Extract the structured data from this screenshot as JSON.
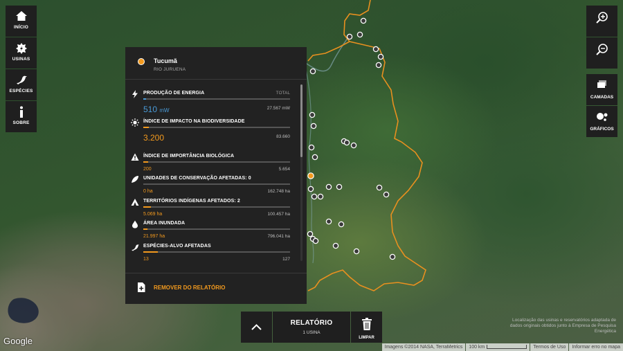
{
  "nav": {
    "items": [
      {
        "label": "INÍCIO",
        "icon": "home-icon"
      },
      {
        "label": "USINAS",
        "icon": "power-plant-icon"
      },
      {
        "label": "ESPÉCIES",
        "icon": "bird-icon"
      },
      {
        "label": "SOBRE",
        "icon": "info-icon"
      }
    ]
  },
  "tools": {
    "zoom_in_icon": "zoom-in-icon",
    "zoom_out_icon": "zoom-out-icon",
    "layers_label": "CAMADAS",
    "charts_label": "GRÁFICOS"
  },
  "panel": {
    "plant_name": "Tucumã",
    "river": "RIO JURUENA",
    "metrics": [
      {
        "title": "PRODUÇÃO DE ENERGIA",
        "total_label": "TOTAL",
        "value": "510",
        "unit": "mW",
        "max": "27.567 mW",
        "fraction": 0.02,
        "color": "blue",
        "icon": "lightning-icon"
      },
      {
        "title": "ÍNDICE DE IMPACTO NA BIODIVERSIDADE",
        "value": "3.200",
        "max": "83.660",
        "fraction": 0.04,
        "color": "orange",
        "icon": "sun-icon"
      },
      {
        "title": "ÍNDICE DE IMPORTÂNCIA BIOLÓGICA",
        "value": "200",
        "max": "5.654",
        "fraction": 0.035,
        "color": "orange",
        "icon": "warning-icon"
      },
      {
        "title": "UNIDADES DE CONSERVAÇÃO AFETADAS: 0",
        "value": "0 ha",
        "max": "162.748 ha",
        "fraction": 0.0,
        "color": "orange",
        "icon": "leaf-icon"
      },
      {
        "title": "TERRITÓRIOS INDÍGENAS AFETADOS: 2",
        "value": "5.069 ha",
        "max": "100.457 ha",
        "fraction": 0.05,
        "color": "orange",
        "icon": "tent-icon"
      },
      {
        "title": "ÁREA INUNDADA",
        "value": "21.997 ha",
        "max": "796.041 ha",
        "fraction": 0.028,
        "color": "orange",
        "icon": "water-drop-icon"
      },
      {
        "title": "ESPÉCIES-ALVO AFETADAS",
        "value": "13",
        "max": "127",
        "fraction": 0.1,
        "color": "orange",
        "icon": "bird-icon"
      }
    ],
    "remove_label": "REMOVER DO RELATÓRIO"
  },
  "report": {
    "title": "RELATÓRIO",
    "count": "1 USINA",
    "clear_label": "LIMPAR"
  },
  "source_note": "Localização das usinas e reservatórios adaptada de dados originais obtidos junto à Empresa de Pesquisa Energética",
  "google": "Google",
  "attribution": {
    "imagery": "Imagens ©2014 NASA, TerraMetrics",
    "scale": "100 km",
    "terms": "Termos de Uso",
    "report_error": "Informar erro no mapa"
  },
  "colors": {
    "accent": "#f39a1e",
    "energy": "#4a9bd8",
    "panel_bg": "#222222",
    "button_bg": "#1f1f1f"
  }
}
